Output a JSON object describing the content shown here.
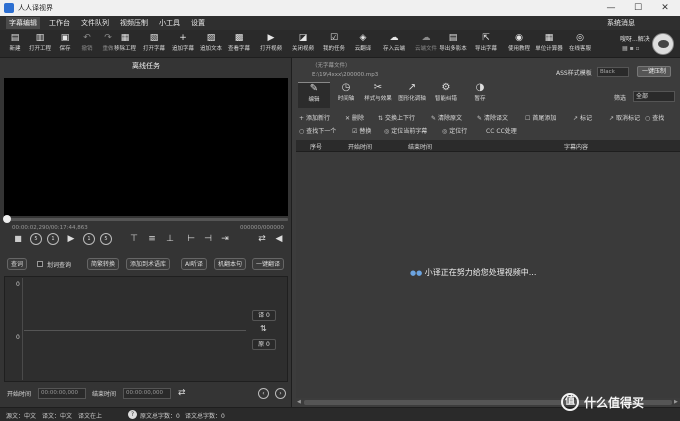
{
  "window": {
    "title": "人人译视界",
    "min": "—",
    "max": "☐",
    "close": "✕"
  },
  "menu": {
    "items": [
      "字幕编辑",
      "工作台",
      "文件队列",
      "视频压制",
      "小工具",
      "设置"
    ],
    "right": "系统消息"
  },
  "toolbar": {
    "items": [
      {
        "label": "新建",
        "icon": "new-icon",
        "glyph": "▤",
        "disabled": false
      },
      {
        "label": "打开工程",
        "icon": "open-project-icon",
        "glyph": "▥",
        "disabled": false
      },
      {
        "label": "保存",
        "icon": "save-icon",
        "glyph": "▣",
        "disabled": false
      },
      {
        "label": "撤销",
        "icon": "undo-icon",
        "glyph": "↶",
        "disabled": true
      },
      {
        "label": "重做",
        "icon": "redo-icon",
        "glyph": "↷",
        "disabled": true
      },
      {
        "label": "移除工程",
        "icon": "remove-project-icon",
        "glyph": "▦",
        "disabled": false
      },
      {
        "label": "打开字幕",
        "icon": "open-subtitle-icon",
        "glyph": "▧",
        "disabled": false
      },
      {
        "label": "追加字幕",
        "icon": "append-subtitle-icon",
        "glyph": "+",
        "disabled": false
      },
      {
        "label": "追加文本",
        "icon": "append-text-icon",
        "glyph": "▨",
        "disabled": false
      },
      {
        "label": "查看字幕",
        "icon": "view-subtitle-icon",
        "glyph": "▩",
        "disabled": false
      },
      {
        "label": "打开视频",
        "icon": "open-video-icon",
        "glyph": "▶",
        "disabled": false
      },
      {
        "label": "关闭视频",
        "icon": "close-video-icon",
        "glyph": "◪",
        "disabled": false
      },
      {
        "label": "我的任务",
        "icon": "my-tasks-icon",
        "glyph": "☑",
        "disabled": false
      },
      {
        "label": "云翻译",
        "icon": "cloud-translate-icon",
        "glyph": "◈",
        "disabled": false
      },
      {
        "label": "存入云端",
        "icon": "cloud-save-icon",
        "glyph": "☁",
        "disabled": false
      },
      {
        "label": "云端文件",
        "icon": "cloud-files-icon",
        "glyph": "☁",
        "disabled": true
      },
      {
        "label": "导出多影本",
        "icon": "export-multi-icon",
        "glyph": "▤",
        "disabled": false
      },
      {
        "label": "导出字幕",
        "icon": "export-subtitle-icon",
        "glyph": "⇱",
        "disabled": false
      },
      {
        "label": "使用教程",
        "icon": "tutorial-icon",
        "glyph": "◉",
        "disabled": false
      },
      {
        "label": "单位计算器",
        "icon": "calculator-icon",
        "glyph": "▦",
        "disabled": false
      },
      {
        "label": "在线客服",
        "icon": "support-icon",
        "glyph": "◎",
        "disabled": false
      }
    ],
    "user_line1": "嗖呀...解决",
    "user_line2": "▦ ▪ ▫"
  },
  "left_panel": {
    "title": "离线任务",
    "time_current": "00:00:02,290/00:17:44,863",
    "time_right": "000000/000000",
    "controls": [
      {
        "name": "stop-button",
        "glyph": "■",
        "circle": false
      },
      {
        "name": "rewind-5-button",
        "glyph": "5",
        "circle": true
      },
      {
        "name": "rewind-1-button",
        "glyph": "1",
        "circle": true
      },
      {
        "name": "play-button",
        "glyph": "▶",
        "circle": false
      },
      {
        "name": "forward-1-button",
        "glyph": "1",
        "circle": true
      },
      {
        "name": "forward-5-button",
        "glyph": "5",
        "circle": true
      },
      {
        "name": "align-top-button",
        "glyph": "⊤",
        "circle": false
      },
      {
        "name": "align-middle-button",
        "glyph": "≡",
        "circle": false
      },
      {
        "name": "align-bottom-button",
        "glyph": "⊥",
        "circle": false
      },
      {
        "name": "set-start-button",
        "glyph": "⊢",
        "circle": false
      },
      {
        "name": "set-end-button",
        "glyph": "⊣",
        "circle": false
      },
      {
        "name": "jump-button",
        "glyph": "⇥",
        "circle": false
      },
      {
        "name": "loop-button",
        "glyph": "⇄",
        "circle": false
      },
      {
        "name": "volume-button",
        "glyph": "◀",
        "circle": false
      }
    ],
    "tools": {
      "query": "查词",
      "check_label": "划词查询",
      "convert": "简繁转换",
      "add_term": "添加到术语库",
      "ai_listen": "AI听译",
      "machine_text": "机翻本句",
      "one_key": "一键翻译"
    },
    "wave": {
      "top_num": "0",
      "mid_num": "0",
      "translated_chip": "译 0",
      "original_chip": "原 0",
      "swap": "⇅"
    },
    "bottom": {
      "start_label": "开始时间",
      "start_value": "00:00:00,000",
      "end_label": "结束时间",
      "end_value": "00:00:00,000"
    }
  },
  "right_panel": {
    "file_name": "（无字幕文件）",
    "file_path": "E:\\19\\4xxx\\200000.mp3",
    "ass_label": "ASS样式模板",
    "ass_value": "Black",
    "ass_button": "一键压制",
    "tabs": [
      {
        "label": "编辑",
        "icon": "edit-icon",
        "glyph": "✎",
        "active": true
      },
      {
        "label": "时间轴",
        "icon": "timeline-icon",
        "glyph": "◷",
        "active": false
      },
      {
        "label": "样式与效果",
        "icon": "style-icon",
        "glyph": "✂",
        "active": false
      },
      {
        "label": "图形化调轴",
        "icon": "graph-timeline-icon",
        "glyph": "↗",
        "active": false
      },
      {
        "label": "智能纠错",
        "icon": "smart-fix-icon",
        "glyph": "⚙",
        "active": false
      },
      {
        "label": "暂存",
        "icon": "temp-save-icon",
        "glyph": "◑",
        "active": false
      }
    ],
    "filter_label": "筛选",
    "filter_value": "全部",
    "actions_row1": [
      {
        "label": "添加新行",
        "glyph": "+"
      },
      {
        "label": "删除",
        "glyph": "✕"
      },
      {
        "label": "交换上下行",
        "glyph": "⇅"
      },
      {
        "label": "清除原文",
        "glyph": "✎"
      },
      {
        "label": "清除译文",
        "glyph": "✎"
      },
      {
        "label": "首尾添加",
        "glyph": "☐"
      },
      {
        "label": "标记",
        "glyph": "↗"
      },
      {
        "label": "取消标记",
        "glyph": "↗"
      },
      {
        "label": "查找",
        "glyph": "○"
      }
    ],
    "actions_row2": [
      {
        "label": "查找下一个",
        "glyph": "○"
      },
      {
        "label": "替换",
        "glyph": "☑"
      },
      {
        "label": "定位当前字幕",
        "glyph": "◎"
      },
      {
        "label": "定位行",
        "glyph": "◎"
      },
      {
        "label": "CC处理",
        "glyph": "CC"
      }
    ],
    "columns": [
      "序号",
      "开始时间",
      "结束时间",
      "字幕内容"
    ],
    "loading_text": "小译正在努力给您处理视频中..."
  },
  "status": {
    "source_lang": "源文：中文",
    "target_lang": "译文：中文",
    "mode": "译文在上",
    "original_count": "原文总字数：0",
    "translated_count": "译文总字数：0"
  },
  "watermark": {
    "badge": "值",
    "text": "什么值得买"
  }
}
